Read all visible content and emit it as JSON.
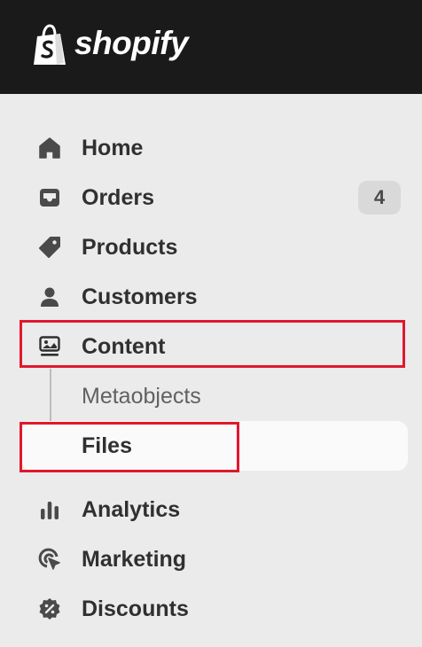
{
  "brand": {
    "name": "shopify",
    "logo_icon": "shopify-bag-icon"
  },
  "nav": {
    "items": [
      {
        "label": "Home",
        "icon": "home-icon"
      },
      {
        "label": "Orders",
        "icon": "inbox-icon",
        "badge": "4"
      },
      {
        "label": "Products",
        "icon": "tag-icon"
      },
      {
        "label": "Customers",
        "icon": "person-icon"
      },
      {
        "label": "Content",
        "icon": "image-icon"
      },
      {
        "label": "Metaobjects"
      },
      {
        "label": "Files"
      },
      {
        "label": "Analytics",
        "icon": "bar-chart-icon"
      },
      {
        "label": "Marketing",
        "icon": "target-icon"
      },
      {
        "label": "Discounts",
        "icon": "discount-icon"
      }
    ]
  },
  "colors": {
    "topbar": "#1a1a1a",
    "sidebar": "#ebebeb",
    "highlight": "#e0182d",
    "active_bg": "#fafafa"
  }
}
